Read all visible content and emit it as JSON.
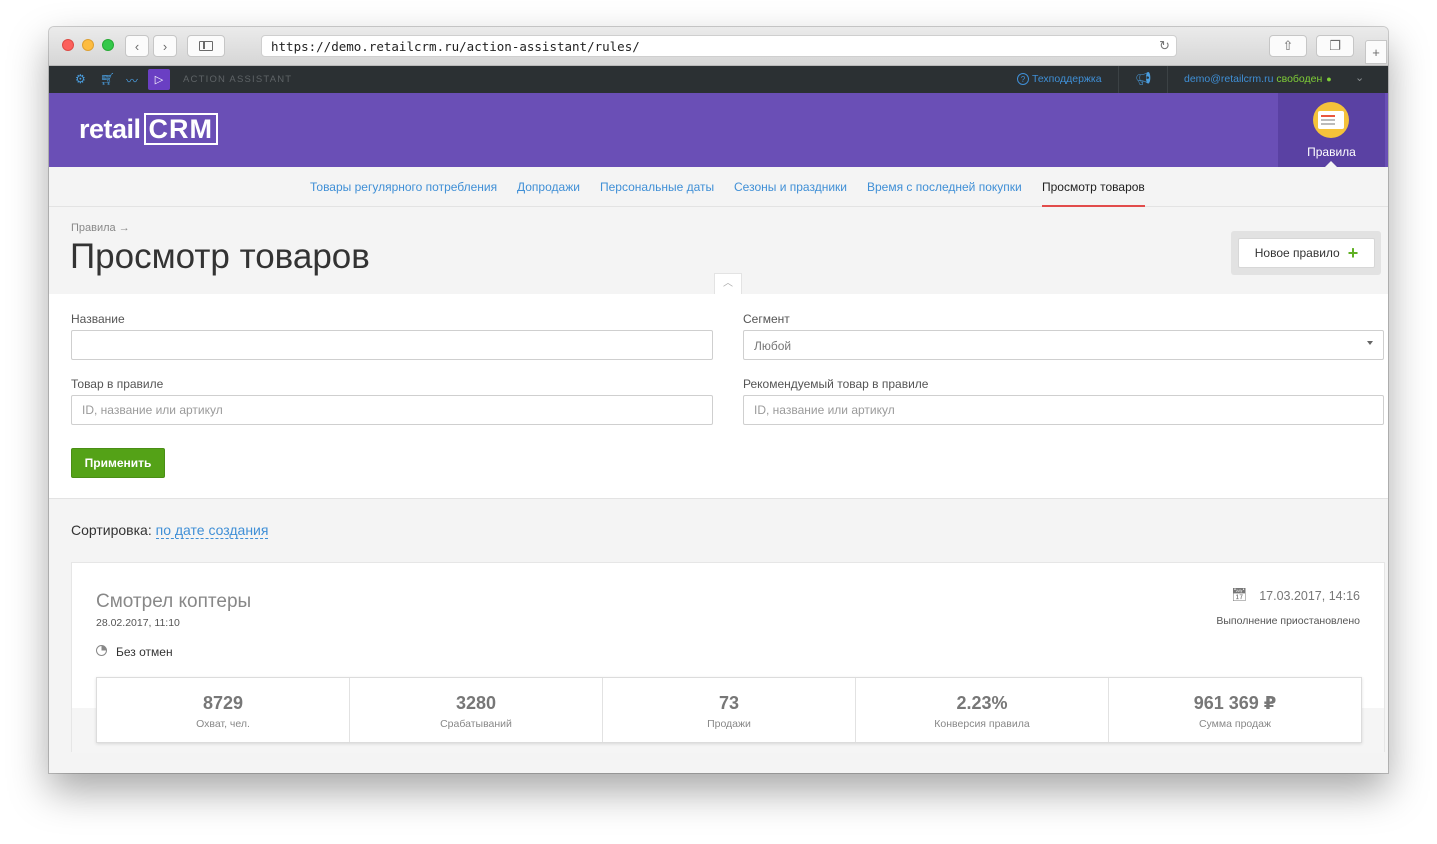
{
  "browser": {
    "url": "https://demo.retailcrm.ru/action-assistant/rules/"
  },
  "appbar": {
    "section_label": "ACTION ASSISTANT",
    "support_label": "Техподдержка",
    "user_email": "demo@retailcrm.ru",
    "user_status": "свободен"
  },
  "header": {
    "logo_text": "retail",
    "logo_crm": "CRM",
    "rules_tab_label": "Правила"
  },
  "subnav": {
    "items": [
      "Товары регулярного потребления",
      "Допродажи",
      "Персональные даты",
      "Сезоны и праздники",
      "Время с последней покупки",
      "Просмотр товаров"
    ],
    "active_index": 5
  },
  "page": {
    "breadcrumb": "Правила →",
    "title": "Просмотр товаров",
    "new_rule_label": "Новое правило"
  },
  "filters": {
    "name_label": "Название",
    "name_value": "",
    "segment_label": "Сегмент",
    "segment_value": "Любой",
    "product_label": "Товар в правиле",
    "product_placeholder": "ID, название или артикул",
    "recommended_label": "Рекомендуемый товар в правиле",
    "recommended_placeholder": "ID, название или артикул",
    "apply_label": "Применить"
  },
  "sorting": {
    "label": "Сортировка:",
    "value": "по дате создания"
  },
  "rule": {
    "title": "Смотрел коптеры",
    "created": "28.02.2017, 11:10",
    "scheduled_date": "17.03.2017, 14:16",
    "status": "Выполнение приостановлено",
    "cancel_mode": "Без отмен",
    "stats": [
      {
        "value": "8729",
        "label": "Охват, чел."
      },
      {
        "value": "3280",
        "label": "Срабатываний"
      },
      {
        "value": "73",
        "label": "Продажи"
      },
      {
        "value": "2.23%",
        "label": "Конверсия правила"
      },
      {
        "value": "961 369 ₽",
        "label": "Сумма продаж"
      }
    ]
  },
  "colors": {
    "header_purple": "#6a4fb6",
    "link_blue": "#3f8fd6",
    "apply_green": "#54a217",
    "active_underline": "#e24c4b"
  }
}
